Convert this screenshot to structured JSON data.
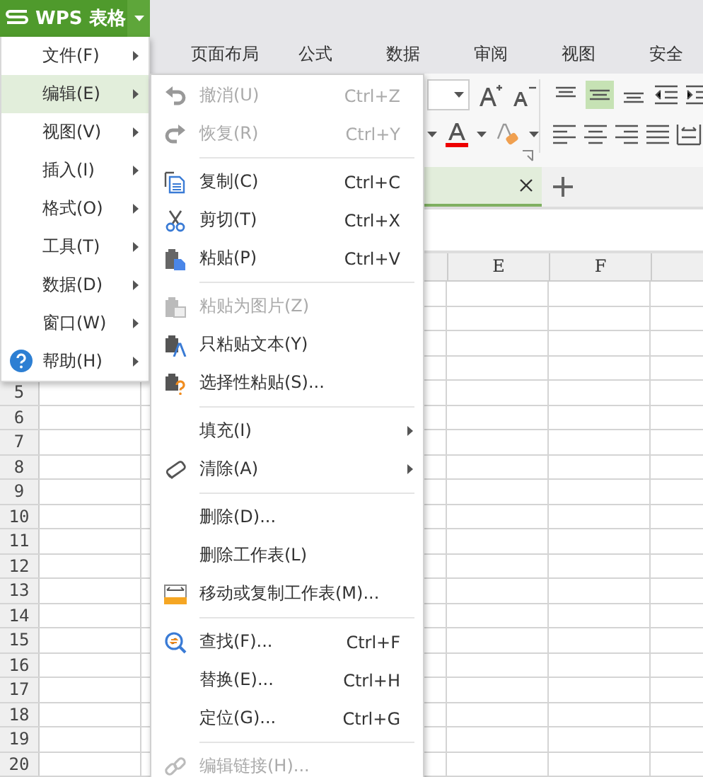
{
  "app": {
    "title": "WPS 表格"
  },
  "ribbon_tabs": [
    {
      "label": "页面布局"
    },
    {
      "label": "公式"
    },
    {
      "label": "数据"
    },
    {
      "label": "审阅"
    },
    {
      "label": "视图"
    },
    {
      "label": "安全"
    }
  ],
  "vertical_align": [
    {
      "selected": false
    },
    {
      "selected": true
    },
    {
      "selected": false
    }
  ],
  "sheet_tabs": [
    {
      "selected": true
    }
  ],
  "column_headers": [
    "E",
    "F"
  ],
  "row_headers": [
    "5",
    "6",
    "7",
    "8",
    "9",
    "10",
    "11",
    "12",
    "13",
    "14",
    "15",
    "16",
    "17",
    "18",
    "19",
    "20"
  ],
  "main_menu": [
    {
      "label": "文件(F)",
      "selected": false
    },
    {
      "label": "编辑(E)",
      "selected": true
    },
    {
      "label": "视图(V)",
      "selected": false
    },
    {
      "label": "插入(I)",
      "selected": false
    },
    {
      "label": "格式(O)",
      "selected": false
    },
    {
      "label": "工具(T)",
      "selected": false
    },
    {
      "label": "数据(D)",
      "selected": false
    },
    {
      "label": "窗口(W)",
      "selected": false
    },
    {
      "label": "帮助(H)",
      "selected": false
    }
  ],
  "edit_menu": [
    {
      "kind": "item",
      "label": "撤消(U)",
      "shortcut": "Ctrl+Z",
      "disabled": true,
      "submenu": false
    },
    {
      "kind": "item",
      "label": "恢复(R)",
      "shortcut": "Ctrl+Y",
      "disabled": true,
      "submenu": false
    },
    {
      "kind": "separator"
    },
    {
      "kind": "item",
      "label": "复制(C)",
      "shortcut": "Ctrl+C",
      "disabled": false,
      "submenu": false
    },
    {
      "kind": "item",
      "label": "剪切(T)",
      "shortcut": "Ctrl+X",
      "disabled": false,
      "submenu": false
    },
    {
      "kind": "item",
      "label": "粘贴(P)",
      "shortcut": "Ctrl+V",
      "disabled": false,
      "submenu": false
    },
    {
      "kind": "separator"
    },
    {
      "kind": "item",
      "label": "粘贴为图片(Z)",
      "disabled": true,
      "submenu": false
    },
    {
      "kind": "item",
      "label": "只粘贴文本(Y)",
      "disabled": false,
      "submenu": false
    },
    {
      "kind": "item",
      "label": "选择性粘贴(S)...",
      "disabled": false,
      "submenu": false
    },
    {
      "kind": "separator"
    },
    {
      "kind": "item",
      "label": "填充(I)",
      "disabled": false,
      "submenu": true
    },
    {
      "kind": "item",
      "label": "清除(A)",
      "disabled": false,
      "submenu": true
    },
    {
      "kind": "separator"
    },
    {
      "kind": "item",
      "label": "删除(D)...",
      "disabled": false,
      "submenu": false
    },
    {
      "kind": "item",
      "label": "删除工作表(L)",
      "disabled": false,
      "submenu": false
    },
    {
      "kind": "item",
      "label": "移动或复制工作表(M)...",
      "disabled": false,
      "submenu": false
    },
    {
      "kind": "separator"
    },
    {
      "kind": "item",
      "label": "查找(F)...",
      "shortcut": "Ctrl+F",
      "disabled": false,
      "submenu": false
    },
    {
      "kind": "item",
      "label": "替换(E)...",
      "shortcut": "Ctrl+H",
      "disabled": false,
      "submenu": false
    },
    {
      "kind": "item",
      "label": "定位(G)...",
      "shortcut": "Ctrl+G",
      "disabled": false,
      "submenu": false
    },
    {
      "kind": "separator"
    },
    {
      "kind": "item",
      "label": "编辑链接(H)...",
      "disabled": true,
      "submenu": false
    }
  ]
}
